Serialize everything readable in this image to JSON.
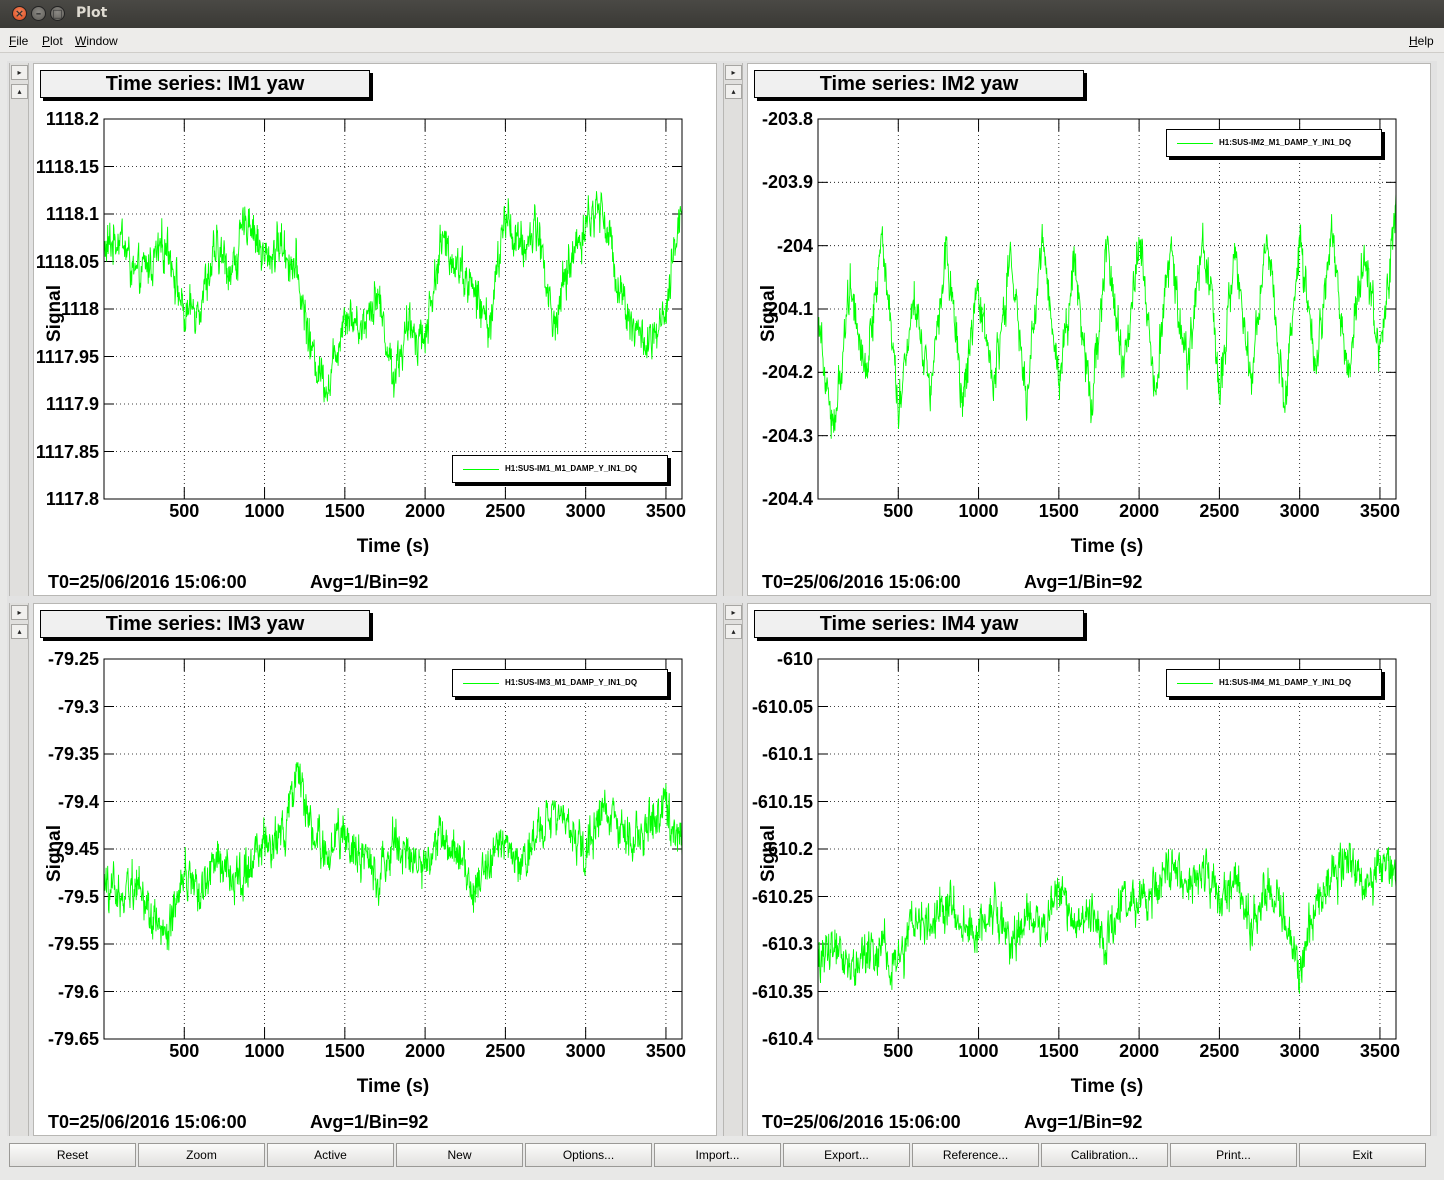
{
  "window": {
    "title": "Plot"
  },
  "menu": {
    "file": "File",
    "plot": "Plot",
    "window": "Window",
    "help": "Help"
  },
  "colors": {
    "trace": "#00ff00",
    "grid": "#000000"
  },
  "plots": [
    {
      "title": "Time series: IM1 yaw",
      "ylabel": "Signal",
      "xlabel": "Time (s)",
      "yticks": [
        "1118.2",
        "1118.15",
        "1118.1",
        "1118.05",
        "1118",
        "1117.95",
        "1117.9",
        "1117.85",
        "1117.8"
      ],
      "xticks": [
        "500",
        "1000",
        "1500",
        "2000",
        "2500",
        "3000",
        "3500"
      ],
      "t0": "T0=25/06/2016 15:06:00",
      "avg": "Avg=1/Bin=92",
      "legend": "H1:SUS-IM1_M1_DAMP_Y_IN1_DQ",
      "legend_pos": "bottom-right"
    },
    {
      "title": "Time series: IM2 yaw",
      "ylabel": "Signal",
      "xlabel": "Time (s)",
      "yticks": [
        "-203.8",
        "-203.9",
        "-204",
        "-204.1",
        "-204.2",
        "-204.3",
        "-204.4"
      ],
      "xticks": [
        "500",
        "1000",
        "1500",
        "2000",
        "2500",
        "3000",
        "3500"
      ],
      "t0": "T0=25/06/2016 15:06:00",
      "avg": "Avg=1/Bin=92",
      "legend": "H1:SUS-IM2_M1_DAMP_Y_IN1_DQ",
      "legend_pos": "top-right"
    },
    {
      "title": "Time series: IM3 yaw",
      "ylabel": "Signal",
      "xlabel": "Time (s)",
      "yticks": [
        "-79.25",
        "-79.3",
        "-79.35",
        "-79.4",
        "-79.45",
        "-79.5",
        "-79.55",
        "-79.6",
        "-79.65"
      ],
      "xticks": [
        "500",
        "1000",
        "1500",
        "2000",
        "2500",
        "3000",
        "3500"
      ],
      "t0": "T0=25/06/2016 15:06:00",
      "avg": "Avg=1/Bin=92",
      "legend": "H1:SUS-IM3_M1_DAMP_Y_IN1_DQ",
      "legend_pos": "top-right"
    },
    {
      "title": "Time series: IM4 yaw",
      "ylabel": "Signal",
      "xlabel": "Time (s)",
      "yticks": [
        "-610",
        "-610.05",
        "-610.1",
        "-610.15",
        "-610.2",
        "-610.25",
        "-610.3",
        "-610.35",
        "-610.4"
      ],
      "xticks": [
        "500",
        "1000",
        "1500",
        "2000",
        "2500",
        "3000",
        "3500"
      ],
      "t0": "T0=25/06/2016 15:06:00",
      "avg": "Avg=1/Bin=92",
      "legend": "H1:SUS-IM4_M1_DAMP_Y_IN1_DQ",
      "legend_pos": "top-right"
    }
  ],
  "chart_data": [
    {
      "type": "line",
      "title": "Time series: IM1 yaw",
      "xlabel": "Time (s)",
      "ylabel": "Signal",
      "xlim": [
        0,
        3600
      ],
      "ylim": [
        1117.8,
        1118.2
      ],
      "grid": true,
      "series": [
        {
          "name": "H1:SUS-IM1_M1_DAMP_Y_IN1_DQ",
          "x": [
            0,
            100,
            200,
            300,
            400,
            500,
            600,
            700,
            800,
            900,
            1000,
            1100,
            1200,
            1300,
            1400,
            1500,
            1600,
            1700,
            1800,
            1900,
            2000,
            2100,
            2200,
            2300,
            2400,
            2500,
            2600,
            2700,
            2800,
            2900,
            3000,
            3100,
            3200,
            3300,
            3400,
            3500,
            3600
          ],
          "y": [
            1118.06,
            1118.08,
            1118.03,
            1118.05,
            1118.07,
            1117.99,
            1118.01,
            1118.06,
            1118.04,
            1118.1,
            1118.05,
            1118.07,
            1118.04,
            1117.95,
            1117.92,
            1118.0,
            1117.98,
            1118.02,
            1117.93,
            1117.98,
            1117.97,
            1118.07,
            1118.05,
            1118.02,
            1117.98,
            1118.1,
            1118.06,
            1118.09,
            1117.98,
            1118.05,
            1118.09,
            1118.11,
            1118.03,
            1117.98,
            1117.96,
            1117.99,
            1118.12
          ]
        }
      ]
    },
    {
      "type": "line",
      "title": "Time series: IM2 yaw",
      "xlabel": "Time (s)",
      "ylabel": "Signal",
      "xlim": [
        0,
        3600
      ],
      "ylim": [
        -204.4,
        -203.8
      ],
      "grid": true,
      "series": [
        {
          "name": "H1:SUS-IM2_M1_DAMP_Y_IN1_DQ",
          "x": [
            0,
            100,
            200,
            300,
            400,
            500,
            600,
            700,
            800,
            900,
            1000,
            1100,
            1200,
            1300,
            1400,
            1500,
            1600,
            1700,
            1800,
            1900,
            2000,
            2100,
            2200,
            2300,
            2400,
            2500,
            2600,
            2700,
            2800,
            2900,
            3000,
            3100,
            3200,
            3300,
            3400,
            3500,
            3600
          ],
          "y": [
            -204.1,
            -204.3,
            -204.05,
            -204.2,
            -203.98,
            -204.25,
            -204.08,
            -204.22,
            -204.0,
            -204.25,
            -204.08,
            -204.22,
            -204.02,
            -204.25,
            -203.98,
            -204.22,
            -204.02,
            -204.25,
            -204.0,
            -204.2,
            -203.98,
            -204.22,
            -204.0,
            -204.2,
            -203.98,
            -204.22,
            -204.02,
            -204.2,
            -203.98,
            -204.25,
            -204.0,
            -204.2,
            -203.98,
            -204.22,
            -204.0,
            -204.18,
            -203.95
          ]
        }
      ]
    },
    {
      "type": "line",
      "title": "Time series: IM3 yaw",
      "xlabel": "Time (s)",
      "ylabel": "Signal",
      "xlim": [
        0,
        3600
      ],
      "ylim": [
        -79.65,
        -79.25
      ],
      "grid": true,
      "series": [
        {
          "name": "H1:SUS-IM3_M1_DAMP_Y_IN1_DQ",
          "x": [
            0,
            100,
            200,
            300,
            400,
            500,
            600,
            700,
            800,
            900,
            1000,
            1100,
            1200,
            1300,
            1400,
            1500,
            1600,
            1700,
            1800,
            1900,
            2000,
            2100,
            2200,
            2300,
            2400,
            2500,
            2600,
            2700,
            2800,
            2900,
            3000,
            3100,
            3200,
            3300,
            3400,
            3500,
            3600
          ],
          "y": [
            -79.49,
            -79.5,
            -79.48,
            -79.52,
            -79.55,
            -79.47,
            -79.5,
            -79.46,
            -79.48,
            -79.47,
            -79.45,
            -79.44,
            -79.38,
            -79.43,
            -79.46,
            -79.43,
            -79.46,
            -79.48,
            -79.44,
            -79.46,
            -79.47,
            -79.43,
            -79.45,
            -79.5,
            -79.46,
            -79.44,
            -79.47,
            -79.43,
            -79.41,
            -79.43,
            -79.46,
            -79.4,
            -79.43,
            -79.44,
            -79.42,
            -79.41,
            -79.44
          ]
        }
      ]
    },
    {
      "type": "line",
      "title": "Time series: IM4 yaw",
      "xlabel": "Time (s)",
      "ylabel": "Signal",
      "xlim": [
        0,
        3600
      ],
      "ylim": [
        -610.4,
        -610.0
      ],
      "grid": true,
      "series": [
        {
          "name": "H1:SUS-IM4_M1_DAMP_Y_IN1_DQ",
          "x": [
            0,
            100,
            200,
            300,
            400,
            500,
            600,
            700,
            800,
            900,
            1000,
            1100,
            1200,
            1300,
            1400,
            1500,
            1600,
            1700,
            1800,
            1900,
            2000,
            2100,
            2200,
            2300,
            2400,
            2500,
            2600,
            2700,
            2800,
            2900,
            3000,
            3100,
            3200,
            3300,
            3400,
            3500,
            3600
          ],
          "y": [
            -610.32,
            -610.3,
            -610.33,
            -610.31,
            -610.3,
            -610.32,
            -610.27,
            -610.29,
            -610.26,
            -610.28,
            -610.29,
            -610.26,
            -610.3,
            -610.27,
            -610.28,
            -610.24,
            -610.29,
            -610.27,
            -610.3,
            -610.25,
            -610.26,
            -610.24,
            -610.22,
            -610.24,
            -610.22,
            -610.25,
            -610.23,
            -610.28,
            -610.24,
            -610.27,
            -610.33,
            -610.26,
            -610.23,
            -610.21,
            -610.24,
            -610.23,
            -610.22
          ]
        }
      ]
    }
  ],
  "buttons": [
    "Reset",
    "Zoom",
    "Active",
    "New",
    "Options...",
    "Import...",
    "Export...",
    "Reference...",
    "Calibration...",
    "Print...",
    "Exit"
  ]
}
